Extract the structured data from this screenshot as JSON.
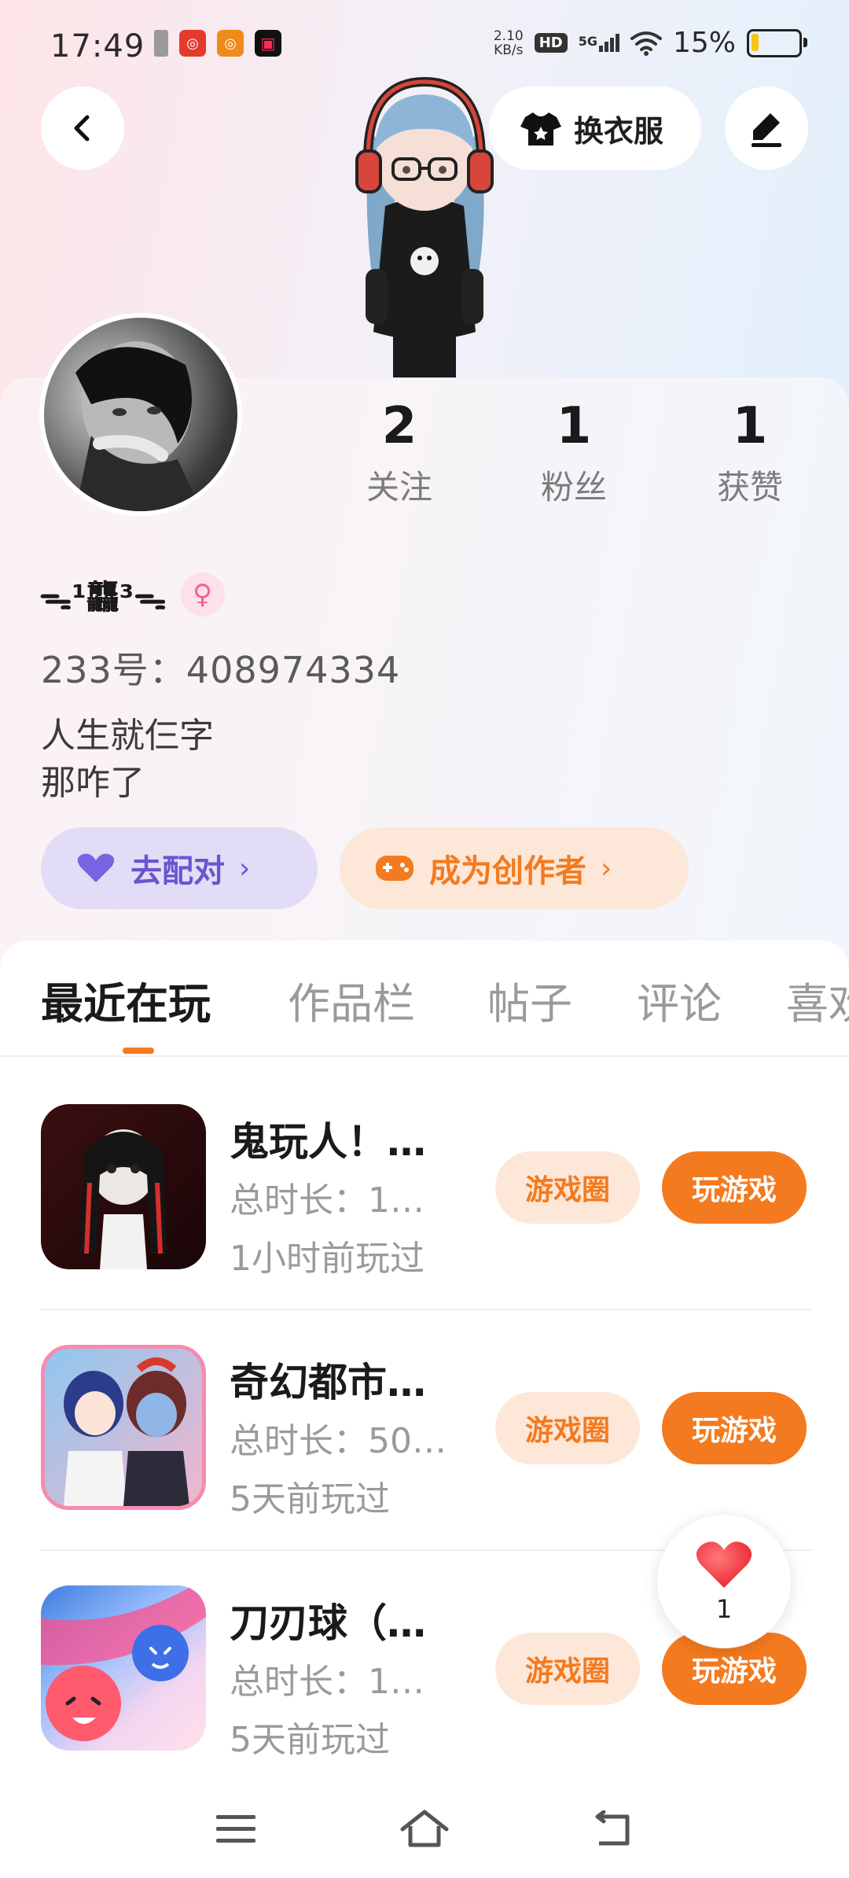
{
  "status_bar": {
    "time": "17:49",
    "net_speed_value": "2.10",
    "net_speed_unit": "KB/s",
    "hd_badge": "HD",
    "signal_label": "5G",
    "battery_percent": "15%",
    "battery_level": 0.15,
    "battery_color": "#f5c518"
  },
  "header": {
    "back_icon": "back-arrow-icon",
    "outfit_label": "换衣服",
    "outfit_icon": "tshirt-icon",
    "edit_icon": "pen-icon"
  },
  "profile": {
    "stats": [
      {
        "value": "2",
        "label": "关注"
      },
      {
        "value": "1",
        "label": "粉丝"
      },
      {
        "value": "1",
        "label": "获赞"
      }
    ],
    "nickname": "ᯓ¹龘³ᯓ",
    "gender_icon": "female-icon",
    "uid": "233号：408974334",
    "bio": "人生就仨字\n那咋了",
    "pair_label": "去配对",
    "creator_label": "成为创作者"
  },
  "tabs": [
    {
      "label": "最近在玩",
      "active": true
    },
    {
      "label": "作品栏",
      "active": false
    },
    {
      "label": "帖子",
      "active": false
    },
    {
      "label": "评论",
      "active": false
    },
    {
      "label": "喜欢",
      "active": false
    }
  ],
  "games": [
    {
      "title": "鬼玩人！…",
      "duration": "总时长：1…",
      "last_played": "1小时前玩过",
      "circle_label": "游戏圈",
      "play_label": "玩游戏"
    },
    {
      "title": "奇幻都市…",
      "duration": "总时长：50…",
      "last_played": "5天前玩过",
      "circle_label": "游戏圈",
      "play_label": "玩游戏"
    },
    {
      "title": "刀刃球（…",
      "duration": "总时长：1…",
      "last_played": "5天前玩过",
      "circle_label": "游戏圈",
      "play_label": "玩游戏"
    }
  ],
  "like_float": {
    "count": "1",
    "icon": "heart-icon"
  },
  "colors": {
    "accent": "#f47a1f",
    "pair_purple": "#6b54d1",
    "gender_pink": "#f06291"
  },
  "nav_bar": {
    "icons": [
      "menu-icon",
      "home-icon",
      "back-icon"
    ]
  }
}
